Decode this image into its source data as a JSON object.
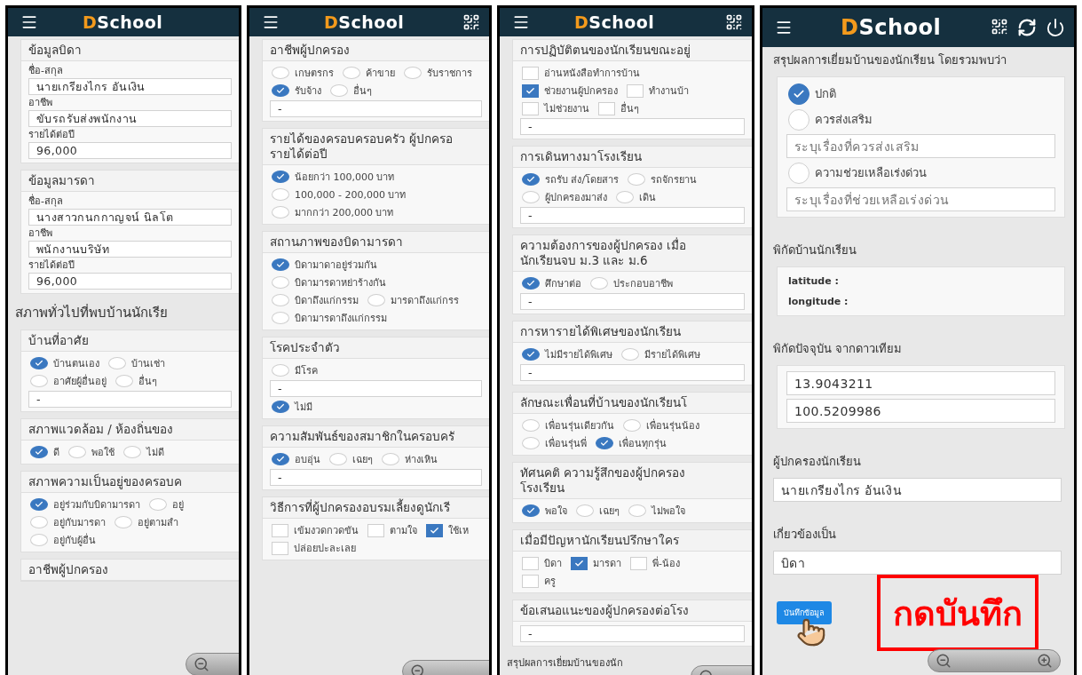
{
  "panels": [
    {
      "header": {
        "logo_mark": "D",
        "logo_text": "School"
      },
      "blocks": [
        {
          "kind": "card",
          "title_lines": [
            "ข้อมูลบิดา"
          ],
          "items": [
            {
              "kind": "label",
              "text": "ชื่อ-สกุล"
            },
            {
              "kind": "field",
              "value": "นายเกรียงไกร อันเงิน"
            },
            {
              "kind": "label",
              "text": "อาชีพ"
            },
            {
              "kind": "field",
              "value": "ขับรถรับส่งพนักงาน"
            },
            {
              "kind": "label",
              "text": "รายได้ต่อปี"
            },
            {
              "kind": "field",
              "value": "96,000"
            }
          ]
        },
        {
          "kind": "card",
          "title_lines": [
            "ข้อมูลมารดา"
          ],
          "items": [
            {
              "kind": "label",
              "text": "ชื่อ-สกุล"
            },
            {
              "kind": "field",
              "value": "นางสาวกนกกาญจน์ นิลโต"
            },
            {
              "kind": "label",
              "text": "อาชีพ"
            },
            {
              "kind": "field",
              "value": "พนักงานบริษัท"
            },
            {
              "kind": "label",
              "text": "รายได้ต่อปี"
            },
            {
              "kind": "field",
              "value": "96,000"
            }
          ]
        },
        {
          "kind": "heading",
          "text": "สภาพทั่วไปที่พบบ้านนักเรีย"
        },
        {
          "kind": "card",
          "title_lines": [
            "บ้านที่อาศัย"
          ],
          "items": [
            {
              "kind": "radios",
              "options": [
                {
                  "label": "บ้านตนเอง",
                  "selected": true
                },
                {
                  "label": "บ้านเช่า",
                  "selected": false
                }
              ]
            },
            {
              "kind": "radios",
              "options": [
                {
                  "label": "อาศัยผู้อื่นอยู่",
                  "selected": false
                },
                {
                  "label": "อื่นๆ",
                  "selected": false
                }
              ]
            },
            {
              "kind": "field",
              "value": "-"
            }
          ]
        },
        {
          "kind": "card",
          "title_lines": [
            "สภาพแวดล้อม / ห้องถิ่นของ"
          ],
          "items": [
            {
              "kind": "radios",
              "options": [
                {
                  "label": "ดี",
                  "selected": true
                },
                {
                  "label": "พอใช้",
                  "selected": false
                },
                {
                  "label": "ไม่ดี",
                  "selected": false
                }
              ]
            }
          ]
        },
        {
          "kind": "card",
          "title_lines": [
            "สภาพความเป็นอยู่ของครอบค"
          ],
          "items": [
            {
              "kind": "radios",
              "options": [
                {
                  "label": "อยู่ร่วมกับบิดามารดา",
                  "selected": true
                },
                {
                  "label": "อยู่",
                  "selected": false
                }
              ]
            },
            {
              "kind": "radios",
              "options": [
                {
                  "label": "อยู่กับมารดา",
                  "selected": false
                },
                {
                  "label": "อยู่ตามสำ",
                  "selected": false
                }
              ]
            },
            {
              "kind": "radios",
              "options": [
                {
                  "label": "อยู่กับผู้อื่น",
                  "selected": false
                }
              ]
            }
          ]
        },
        {
          "kind": "card",
          "title_lines": [
            "อาชีพผู้ปกครอง"
          ]
        }
      ]
    },
    {
      "header": {
        "logo_mark": "D",
        "logo_text": "School"
      },
      "blocks": [
        {
          "kind": "card",
          "title_lines": [
            "อาชีพผู้ปกครอง"
          ],
          "items": [
            {
              "kind": "radios",
              "options": [
                {
                  "label": "เกษตรกร",
                  "selected": false
                },
                {
                  "label": "ค้าขาย",
                  "selected": false
                },
                {
                  "label": "รับราชการ",
                  "selected": false
                }
              ]
            },
            {
              "kind": "radios",
              "options": [
                {
                  "label": "รับจ้าง",
                  "selected": true
                },
                {
                  "label": "อื่นๆ",
                  "selected": false
                }
              ]
            },
            {
              "kind": "field",
              "value": "-"
            }
          ]
        },
        {
          "kind": "card",
          "title_lines": [
            "รายได้ของครอบครอบครัว ผู้ปกครอ",
            "รายได้ต่อปี"
          ],
          "items": [
            {
              "kind": "radios",
              "options": [
                {
                  "label": "น้อยกว่า 100,000 บาท",
                  "selected": true
                }
              ]
            },
            {
              "kind": "radios",
              "options": [
                {
                  "label": "100,000 - 200,000 บาท",
                  "selected": false
                }
              ]
            },
            {
              "kind": "radios",
              "options": [
                {
                  "label": "มากกว่า 200,000 บาท",
                  "selected": false
                }
              ]
            }
          ]
        },
        {
          "kind": "card",
          "title_lines": [
            "สถานภาพของบิดามารดา"
          ],
          "items": [
            {
              "kind": "radios",
              "options": [
                {
                  "label": "บิดามาดาอยู่ร่วมกัน",
                  "selected": true
                }
              ]
            },
            {
              "kind": "radios",
              "options": [
                {
                  "label": "บิดามารดาหย่าร้างกัน",
                  "selected": false
                }
              ]
            },
            {
              "kind": "radios",
              "options": [
                {
                  "label": "บิดาถึงแก่กรรม",
                  "selected": false
                },
                {
                  "label": "มารดาถึงแก่กรร",
                  "selected": false
                }
              ]
            },
            {
              "kind": "radios",
              "options": [
                {
                  "label": "บิดามารดาถึงแก่กรรม",
                  "selected": false
                }
              ]
            }
          ]
        },
        {
          "kind": "card",
          "title_lines": [
            "โรคประจำตัว"
          ],
          "items": [
            {
              "kind": "radios",
              "options": [
                {
                  "label": "มีโรค",
                  "selected": false
                }
              ]
            },
            {
              "kind": "field",
              "value": "-"
            },
            {
              "kind": "radios",
              "options": [
                {
                  "label": "ไม่มี",
                  "selected": true
                }
              ]
            }
          ]
        },
        {
          "kind": "card",
          "title_lines": [
            "ความสัมพันธ์ของสมาชิกในครอบครั"
          ],
          "items": [
            {
              "kind": "radios",
              "options": [
                {
                  "label": "อบอุ่น",
                  "selected": true
                },
                {
                  "label": "เฉยๆ",
                  "selected": false
                },
                {
                  "label": "ห่างเหิน",
                  "selected": false
                }
              ]
            },
            {
              "kind": "field",
              "value": "-"
            }
          ]
        },
        {
          "kind": "card",
          "title_lines": [
            "วิธีการที่ผู้ปกครองอบรมเลี้ยงดูนักเรี"
          ],
          "items": [
            {
              "kind": "checks",
              "options": [
                {
                  "label": "เข้มงวดกวดขัน",
                  "checked": false
                },
                {
                  "label": "ตามใจ",
                  "checked": false
                },
                {
                  "label": "ใช้เห",
                  "checked": true
                }
              ]
            },
            {
              "kind": "checks",
              "options": [
                {
                  "label": "ปล่อยปะละเลย",
                  "checked": false
                }
              ]
            }
          ]
        }
      ]
    },
    {
      "header": {
        "logo_mark": "D",
        "logo_text": "School"
      },
      "blocks": [
        {
          "kind": "card",
          "title_lines": [
            "การปฏิบัติตนของนักเรียนขณะอยู่"
          ],
          "items": [
            {
              "kind": "checks",
              "options": [
                {
                  "label": "อ่านหนังสือทำการบ้าน",
                  "checked": false
                }
              ]
            },
            {
              "kind": "checks",
              "options": [
                {
                  "label": "ช่วยงานผู้ปกครอง",
                  "checked": true
                },
                {
                  "label": "ทำงานบ้า",
                  "checked": false
                }
              ]
            },
            {
              "kind": "checks",
              "options": [
                {
                  "label": "ไม่ช่วยงาน",
                  "checked": false
                },
                {
                  "label": "อื่นๆ",
                  "checked": false
                }
              ]
            },
            {
              "kind": "field",
              "value": "-"
            }
          ]
        },
        {
          "kind": "card",
          "title_lines": [
            "การเดินทางมาโรงเรียน"
          ],
          "items": [
            {
              "kind": "radios",
              "options": [
                {
                  "label": "รถรับ ส่ง/โดยสาร",
                  "selected": true
                },
                {
                  "label": "รถจักรยาน",
                  "selected": false
                }
              ]
            },
            {
              "kind": "radios",
              "options": [
                {
                  "label": "ผู้ปกครองมาส่ง",
                  "selected": false
                },
                {
                  "label": "เดิน",
                  "selected": false
                }
              ]
            },
            {
              "kind": "field",
              "value": "-"
            }
          ]
        },
        {
          "kind": "card",
          "title_lines": [
            "ความต้องการของผู้ปกครอง เมื่อ",
            "นักเรียนจบ ม.3 และ ม.6"
          ],
          "items": [
            {
              "kind": "radios",
              "options": [
                {
                  "label": "ศึกษาต่อ",
                  "selected": true
                },
                {
                  "label": "ประกอบอาชีพ",
                  "selected": false
                }
              ]
            },
            {
              "kind": "field",
              "value": "-"
            }
          ]
        },
        {
          "kind": "card",
          "title_lines": [
            "การหารายได้พิเศษของนักเรียน"
          ],
          "items": [
            {
              "kind": "radios",
              "options": [
                {
                  "label": "ไม่มีรายได้พิเศษ",
                  "selected": true
                },
                {
                  "label": "มีรายได้พิเศษ",
                  "selected": false
                }
              ]
            },
            {
              "kind": "field",
              "value": "-"
            }
          ]
        },
        {
          "kind": "card",
          "title_lines": [
            "ลักษณะเพื่อนที่บ้านของนักเรียนโ"
          ],
          "items": [
            {
              "kind": "radios",
              "options": [
                {
                  "label": "เพื่อนรุ่นเดียวกัน",
                  "selected": false
                },
                {
                  "label": "เพื่อนรุ่นน้อง",
                  "selected": false
                }
              ]
            },
            {
              "kind": "radios",
              "options": [
                {
                  "label": "เพื่อนรุ่นพี่",
                  "selected": false
                },
                {
                  "label": "เพื่อนทุกรุ่น",
                  "selected": true
                }
              ]
            }
          ]
        },
        {
          "kind": "card",
          "title_lines": [
            "ทัศนคติ ความรู้สึกของผู้ปกครอง",
            "โรงเรียน"
          ],
          "items": [
            {
              "kind": "radios",
              "options": [
                {
                  "label": "พอใจ",
                  "selected": true
                },
                {
                  "label": "เฉยๆ",
                  "selected": false
                },
                {
                  "label": "ไม่พอใจ",
                  "selected": false
                }
              ]
            }
          ]
        },
        {
          "kind": "card",
          "title_lines": [
            "เมื่อมีปัญหานักเรียนปรึกษาใคร"
          ],
          "items": [
            {
              "kind": "checks",
              "options": [
                {
                  "label": "บิดา",
                  "checked": false
                },
                {
                  "label": "มารดา",
                  "checked": true
                },
                {
                  "label": "พี่-น้อง",
                  "checked": false
                }
              ]
            },
            {
              "kind": "checks",
              "options": [
                {
                  "label": "ครู",
                  "checked": false
                }
              ]
            }
          ]
        },
        {
          "kind": "card",
          "title_lines": [
            "ข้อเสนอแนะของผู้ปกครองต่อโรง"
          ],
          "items": [
            {
              "kind": "field",
              "value": "-"
            }
          ]
        },
        {
          "kind": "heading",
          "text": "สรุปผลการเยี่ยมบ้านของนัก"
        }
      ]
    },
    {
      "header": {
        "logo_mark": "D",
        "logo_text": "School"
      },
      "blocks": [
        {
          "kind": "heading",
          "text": "สรุปผลการเยี่ยมบ้านของนักเรียน โดยรวมพบว่า"
        },
        {
          "kind": "card",
          "items": [
            {
              "kind": "radios",
              "options": [
                {
                  "label": "ปกติ",
                  "selected": true
                }
              ]
            },
            {
              "kind": "radios",
              "options": [
                {
                  "label": "ควรส่งเสริม",
                  "selected": false
                }
              ]
            },
            {
              "kind": "field",
              "placeholder": "ระบุเรื่องที่ควรส่งเสริม"
            },
            {
              "kind": "radios",
              "options": [
                {
                  "label": "ความช่วยเหลือเร่งด่วน",
                  "selected": false
                }
              ]
            },
            {
              "kind": "field",
              "placeholder": "ระบุเรื่องที่ช่วยเหลือเร่งด่วน"
            }
          ]
        },
        {
          "kind": "heading",
          "text": "พิกัดบ้านนักเรียน"
        },
        {
          "kind": "card",
          "items": [
            {
              "kind": "note",
              "text": "latitude :"
            },
            {
              "kind": "note",
              "text": "longitude :"
            }
          ]
        },
        {
          "kind": "heading",
          "text": "พิกัดปัจจุบัน จากดาวเทียม"
        },
        {
          "kind": "card",
          "items": [
            {
              "kind": "field",
              "value": "13.9043211"
            },
            {
              "kind": "field",
              "value": "100.5209986"
            }
          ]
        },
        {
          "kind": "heading",
          "text": "ผู้ปกครองนักเรียน"
        },
        {
          "kind": "field",
          "value": "นายเกรียงไกร อันเงิน"
        },
        {
          "kind": "heading",
          "text": "เกี่ยวข้องเป็น"
        },
        {
          "kind": "field",
          "value": "บิดา"
        },
        {
          "kind": "button",
          "label": "บันทึกข้อมูล"
        }
      ],
      "callout": "กดบันทึก"
    }
  ]
}
